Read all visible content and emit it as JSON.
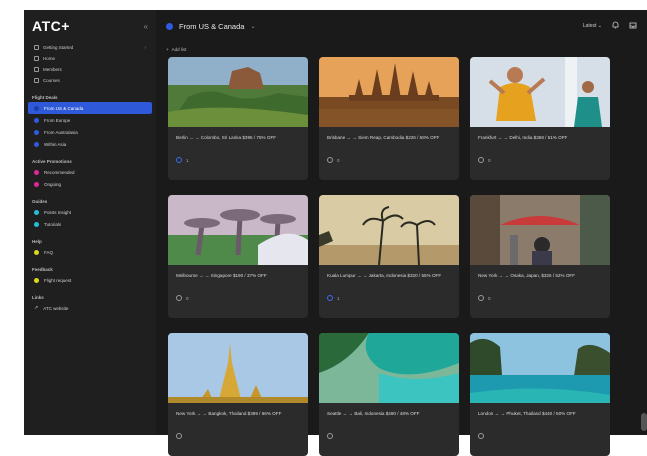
{
  "app": {
    "logo": "ATC+",
    "collapse_glyph": "«"
  },
  "sidebar": {
    "nav": [
      {
        "label": "Getting Started",
        "icon": "rocket-icon",
        "has_chevron": true
      },
      {
        "label": "Home",
        "icon": "home-icon"
      },
      {
        "label": "Members",
        "icon": "users-icon"
      },
      {
        "label": "Courses",
        "icon": "book-icon"
      }
    ],
    "sections": [
      {
        "title": "Flight Deals",
        "items": [
          {
            "label": "From US & Canada",
            "color": "blue",
            "active": true
          },
          {
            "label": "From Europe",
            "color": "blue"
          },
          {
            "label": "From Australasia",
            "color": "blue"
          },
          {
            "label": "Within Asia",
            "color": "blue"
          }
        ]
      },
      {
        "title": "Active Promotions",
        "items": [
          {
            "label": "Recommended",
            "color": "pink"
          },
          {
            "label": "Ongoing",
            "color": "pink"
          }
        ]
      },
      {
        "title": "Guides",
        "items": [
          {
            "label": "Points Insight",
            "color": "teal"
          },
          {
            "label": "Tutorials",
            "color": "teal"
          }
        ]
      },
      {
        "title": "Help",
        "items": [
          {
            "label": "FAQ",
            "color": "yellow"
          }
        ]
      },
      {
        "title": "Feedback",
        "items": [
          {
            "label": "Flight request",
            "color": "yellow"
          }
        ]
      },
      {
        "title": "Links",
        "items": [
          {
            "label": "ATC website",
            "color": "link"
          }
        ]
      }
    ]
  },
  "topbar": {
    "title": "From US & Canada",
    "sort_label": "Latest",
    "bell_icon": "bell-icon",
    "inbox_icon": "inbox-icon"
  },
  "subbar": {
    "add_label": "Add list"
  },
  "cards": [
    {
      "title": "Berlin → → Colombo, Sri Lanka $395 / 75% OFF",
      "likes": "1",
      "liked": true,
      "scene": "rock"
    },
    {
      "title": "Brisbane → → Siem Reap, Cambodia $226 / 58% OFF",
      "likes": "0",
      "liked": false,
      "scene": "temple"
    },
    {
      "title": "Frankfurt → → Delhi, India $368 / 51% OFF",
      "likes": "0",
      "liked": false,
      "scene": "dance"
    },
    {
      "title": "Melbourne → → Singapore $190 / 37% OFF",
      "likes": "0",
      "liked": false,
      "scene": "gardens"
    },
    {
      "title": "Kuala Lumpur → → Jakarta, Indonesia $320 / 55% OFF",
      "likes": "1",
      "liked": true,
      "scene": "palms"
    },
    {
      "title": "New York → → Osaka, Japan, $326 / 52% OFF",
      "likes": "0",
      "liked": false,
      "scene": "street"
    },
    {
      "title": "New York → → Bangkok, Thailand $389 / 66% OFF",
      "likes": "",
      "liked": false,
      "scene": "pagoda"
    },
    {
      "title": "Seattle → → Bali, Indonesia $480 / 48% OFF",
      "likes": "",
      "liked": false,
      "scene": "beach"
    },
    {
      "title": "London → → Phuket, Thailand $440 / 50% OFF",
      "likes": "",
      "liked": false,
      "scene": "bay"
    }
  ]
}
